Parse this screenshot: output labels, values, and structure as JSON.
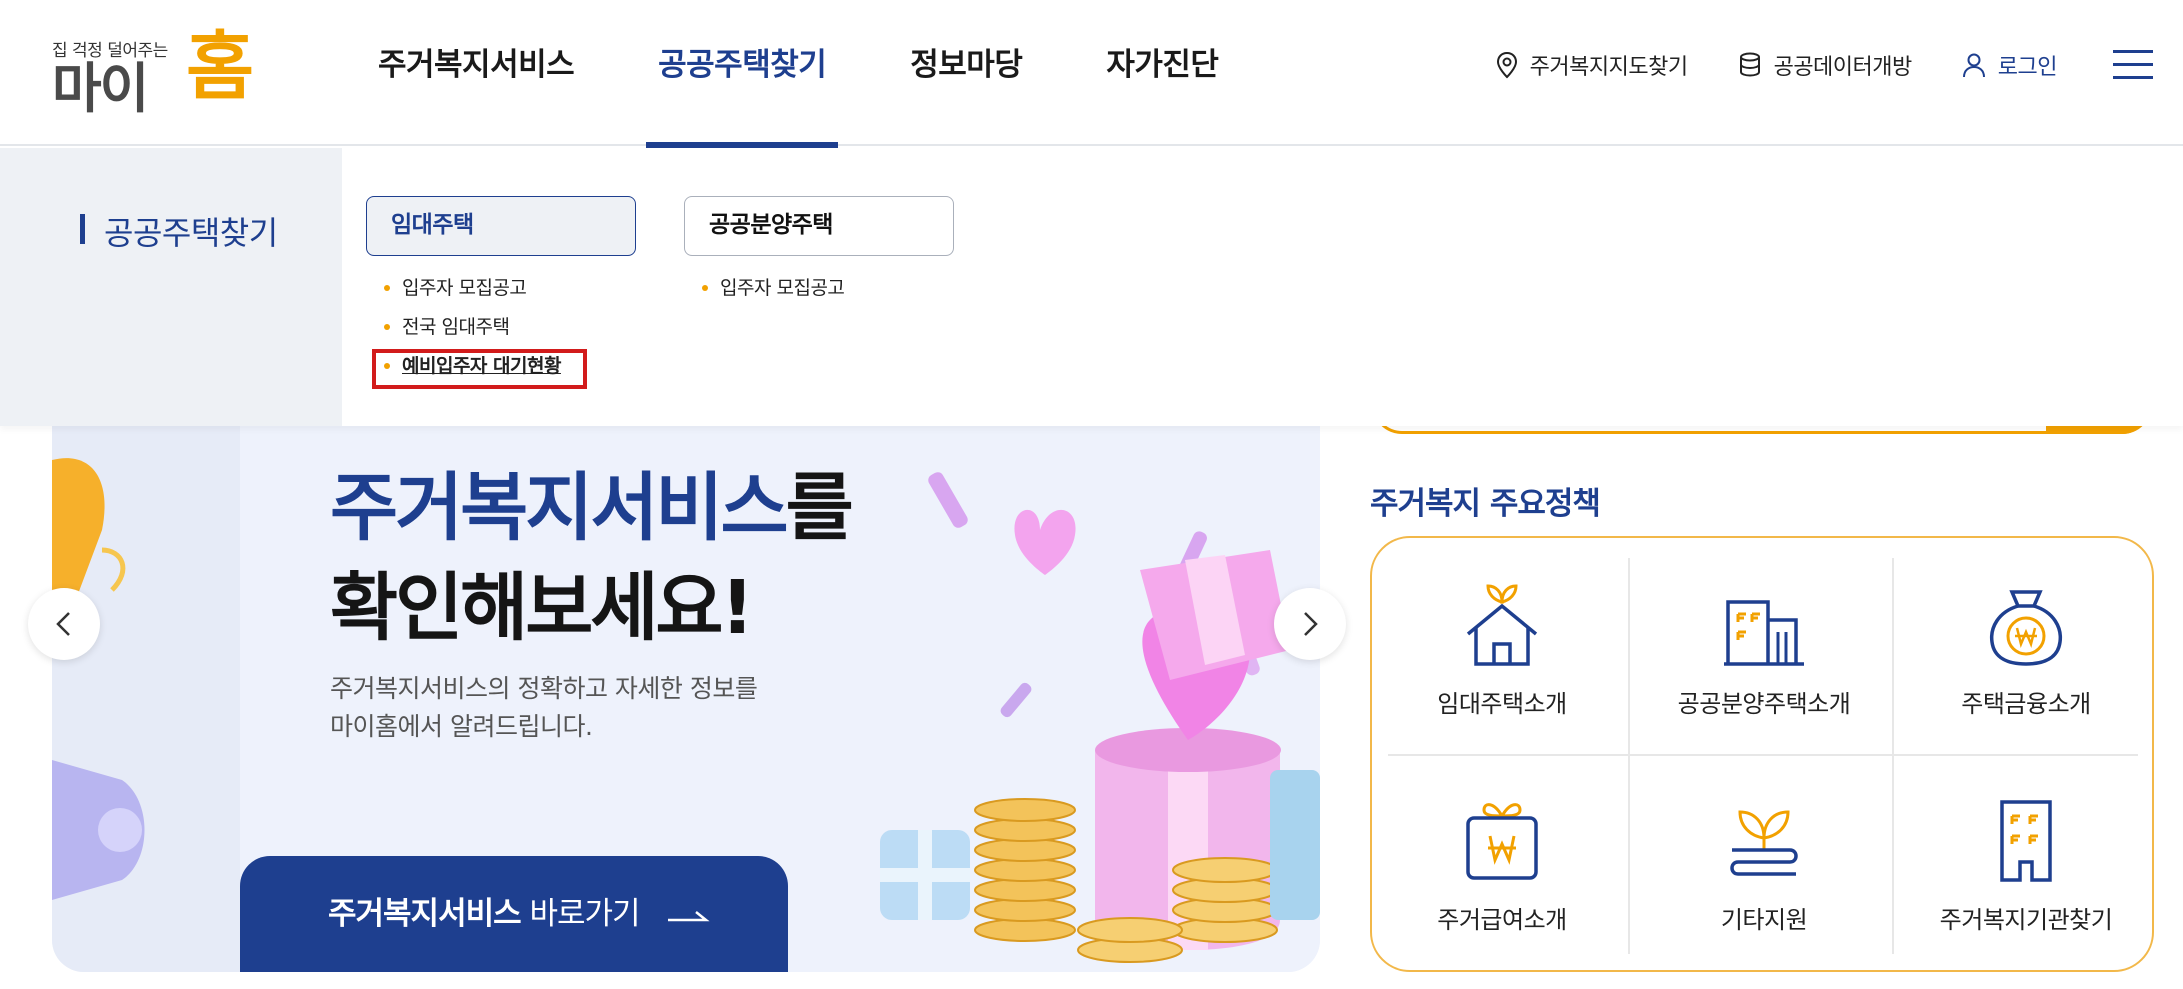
{
  "logo": {
    "tagline": "집 걱정 덜어주는",
    "name_gray": "마이",
    "name_accent": "홈"
  },
  "gnb": [
    {
      "label": "주거복지서비스"
    },
    {
      "label": "공공주택찾기"
    },
    {
      "label": "정보마당"
    },
    {
      "label": "자가진단"
    }
  ],
  "util": {
    "map": "주거복지지도찾기",
    "opendata": "공공데이터개방",
    "login": "로그인"
  },
  "mega": {
    "title": "공공주택찾기",
    "rental": {
      "label": "임대주택",
      "items": [
        "입주자 모집공고",
        "전국 임대주택",
        "예비입주자 대기현황"
      ]
    },
    "sale": {
      "label": "공공분양주택",
      "items": [
        "입주자 모집공고"
      ]
    }
  },
  "banner": {
    "hero_blue": "주거복지서비스",
    "hero_suffix": "를",
    "hero_line2": "확인해보세요!",
    "desc1": "주거복지서비스의 정확하고 자세한 정보를",
    "desc2": "마이홈에서 알려드립니다.",
    "cta_bold": "주거복지서비스",
    "cta_rest": "바로가기"
  },
  "policy": {
    "title": "주거복지 주요정책",
    "items": [
      "임대주택소개",
      "공공분양주택소개",
      "주택금융소개",
      "주거급여소개",
      "기타지원",
      "주거복지기관찾기"
    ]
  },
  "colors": {
    "navy": "#1e3f8f",
    "orange": "#f2a100",
    "highlight": "#d21b1b"
  }
}
